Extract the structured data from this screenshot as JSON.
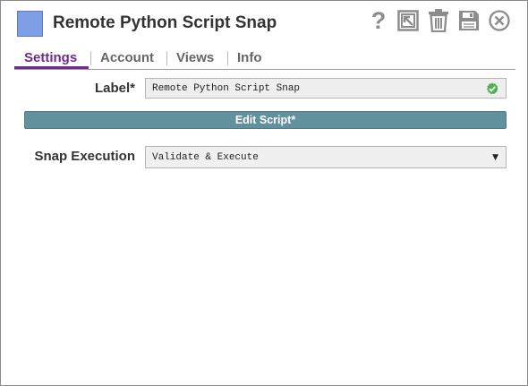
{
  "window": {
    "title": "Remote Python Script Snap",
    "snap_icon": "snap-icon",
    "toolbar": [
      {
        "name": "help-icon"
      },
      {
        "name": "export-icon"
      },
      {
        "name": "delete-icon"
      },
      {
        "name": "save-icon"
      },
      {
        "name": "close-icon"
      }
    ]
  },
  "tabs": [
    {
      "label": "Settings",
      "active": true
    },
    {
      "label": "Account",
      "active": false
    },
    {
      "label": "Views",
      "active": false
    },
    {
      "label": "Info",
      "active": false
    }
  ],
  "settings": {
    "label_field": {
      "label": "Label*",
      "value": "Remote Python Script Snap",
      "status_icon": "check-circle-icon"
    },
    "edit_script_button": "Edit Script*",
    "snap_execution": {
      "label": "Snap Execution",
      "selected": "Validate & Execute"
    }
  },
  "colors": {
    "accent": "#6b2c8f",
    "button": "#62909c",
    "valid": "#4caf50",
    "snap_icon": "#7e9ee8"
  }
}
